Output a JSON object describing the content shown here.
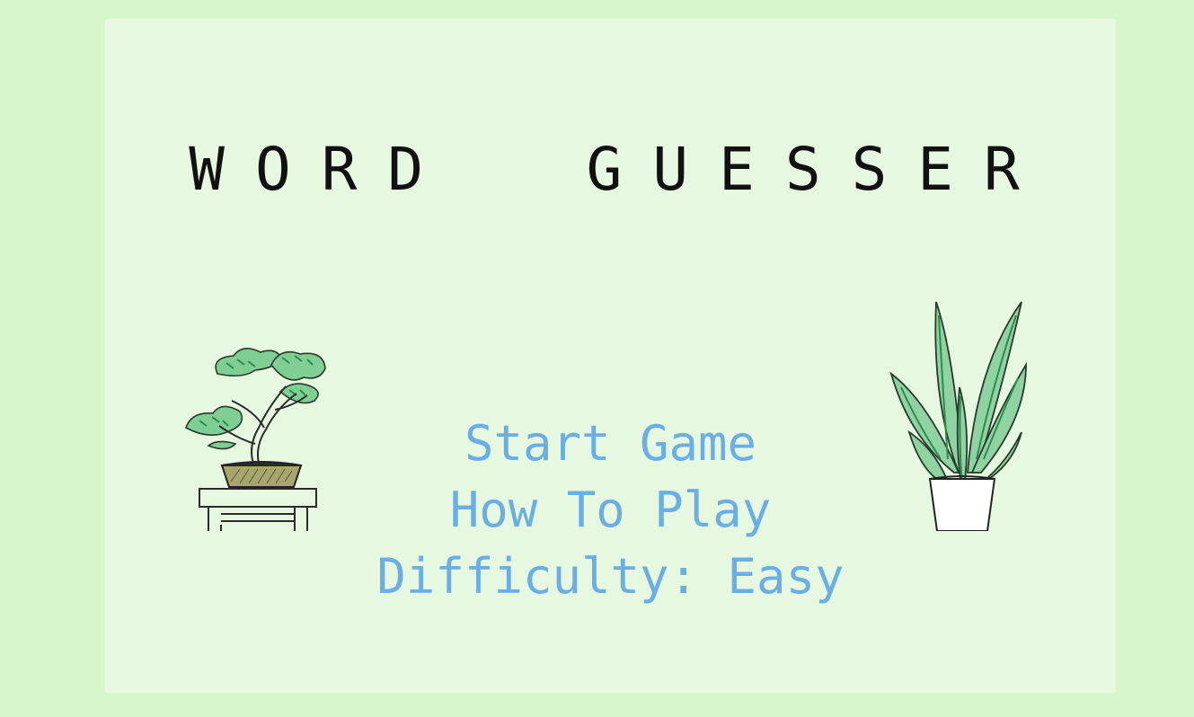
{
  "title": "WORD  GUESSER",
  "menu": {
    "start": "Start Game",
    "how_to_play": "How To Play",
    "difficulty_label": "Difficulty:",
    "difficulty_value": "Easy"
  },
  "illustrations": {
    "left": "bonsai-tree-icon",
    "right": "potted-plant-icon"
  },
  "colors": {
    "background": "#d6f7cc",
    "panel": "#e6f8df",
    "title": "#111111",
    "menu_text": "#6aaee6",
    "leaf_green": "#4fae6c"
  }
}
